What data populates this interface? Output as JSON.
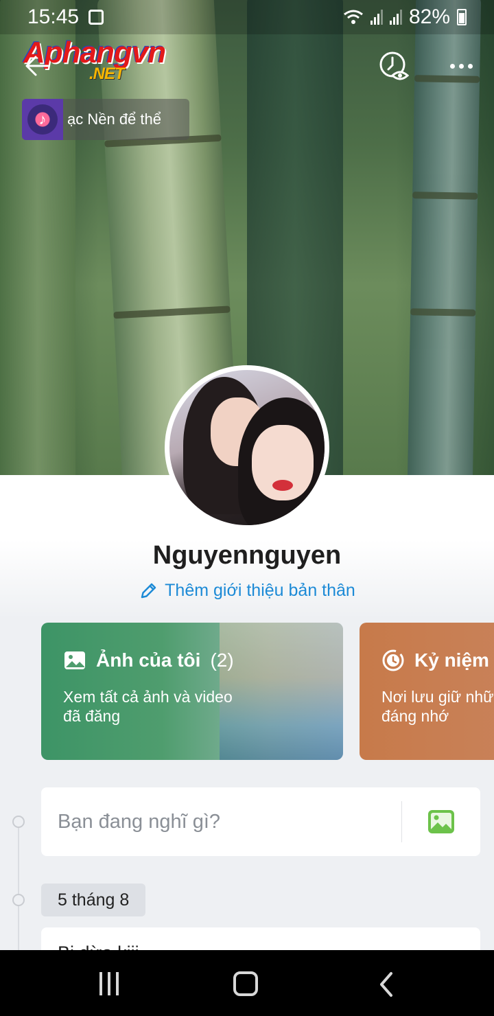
{
  "status_bar": {
    "time": "15:45",
    "battery": "82%"
  },
  "watermark": {
    "logo_main": "Aphangvn",
    "logo_sub": ".NET"
  },
  "header": {
    "back_icon": "arrow-left-icon",
    "history_icon": "clock-eye-icon",
    "more_icon": "more-horizontal-icon"
  },
  "music": {
    "label": "ạc Nền để thể"
  },
  "profile": {
    "name": "Nguyennguyen",
    "add_bio": "Thêm giới thiệu bản thân"
  },
  "cards": {
    "photos": {
      "title": "Ảnh của tôi",
      "count": "(2)",
      "desc_line1": "Xem tất cả ảnh và video",
      "desc_line2": "đã đăng"
    },
    "memories": {
      "title": "Kỷ niệm",
      "desc_line1": "Nơi lưu giữ nhữ",
      "desc_line2": "đáng nhớ"
    }
  },
  "composer": {
    "placeholder": "Bạn đang nghĩ gì?"
  },
  "timeline": {
    "date_label": "5 tháng 8",
    "post_preview": "Bi dừa kiii"
  },
  "colors": {
    "accent_blue": "#1c8ad6",
    "photos_card": "#3d9466",
    "memories_card": "#c77a4a"
  }
}
